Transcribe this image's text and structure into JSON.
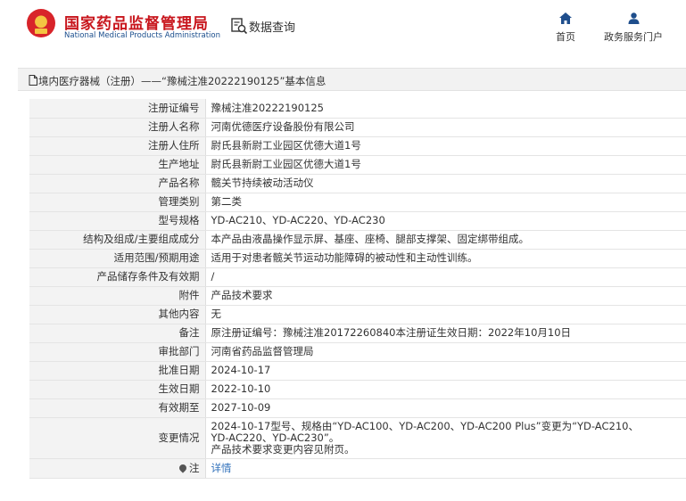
{
  "header": {
    "org_name_cn": "国家药品监督管理局",
    "org_name_en": "National Medical Products Administration",
    "data_query_label": "数据查询",
    "nav": {
      "home_label": "首页",
      "portal_label": "政务服务门户"
    }
  },
  "breadcrumb": {
    "text": "境内医疗器械（注册）——“豫械注准20222190125”基本信息"
  },
  "record": {
    "rows": [
      {
        "label": "注册证编号",
        "value": "豫械注准20222190125"
      },
      {
        "label": "注册人名称",
        "value": "河南优德医疗设备股份有限公司"
      },
      {
        "label": "注册人住所",
        "value": "尉氏县新尉工业园区优德大道1号"
      },
      {
        "label": "生产地址",
        "value": "尉氏县新尉工业园区优德大道1号"
      },
      {
        "label": "产品名称",
        "value": "髋关节持续被动活动仪"
      },
      {
        "label": "管理类别",
        "value": "第二类"
      },
      {
        "label": "型号规格",
        "value": "YD-AC210、YD-AC220、YD-AC230"
      },
      {
        "label": "结构及组成/主要组成成分",
        "value": "本产品由液晶操作显示屏、基座、座椅、腿部支撑架、固定绑带组成。"
      },
      {
        "label": "适用范围/预期用途",
        "value": "适用于对患者髋关节运动功能障碍的被动性和主动性训练。"
      },
      {
        "label": "产品储存条件及有效期",
        "value": "/"
      },
      {
        "label": "附件",
        "value": "产品技术要求"
      },
      {
        "label": "其他内容",
        "value": "无"
      },
      {
        "label": "备注",
        "value": "原注册证编号：豫械注准20172260840本注册证生效日期：2022年10月10日"
      },
      {
        "label": "审批部门",
        "value": "河南省药品监督管理局"
      },
      {
        "label": "批准日期",
        "value": "2024-10-17"
      },
      {
        "label": "生效日期",
        "value": "2022-10-10"
      },
      {
        "label": "有效期至",
        "value": "2027-10-09"
      }
    ],
    "change": {
      "label": "变更情况",
      "line1": "2024-10-17型号、规格由“YD-AC100、YD-AC200、YD-AC200 Plus”变更为“YD-AC210、",
      "line2": "YD-AC220、YD-AC230”。",
      "line3": "产品技术要求变更内容见附页。"
    },
    "note": {
      "label": "注",
      "link_label": "详情"
    }
  },
  "colors": {
    "brand_red": "#c8161d",
    "brand_blue": "#1a4d8c",
    "link_blue": "#2f6fba",
    "label_bg": "#f3f3f3"
  },
  "icons": {
    "emblem": "national-emblem",
    "data_query": "search-document-icon",
    "home": "home-icon",
    "portal": "user-icon",
    "breadcrumb": "document-icon",
    "note": "location-pin-icon"
  }
}
